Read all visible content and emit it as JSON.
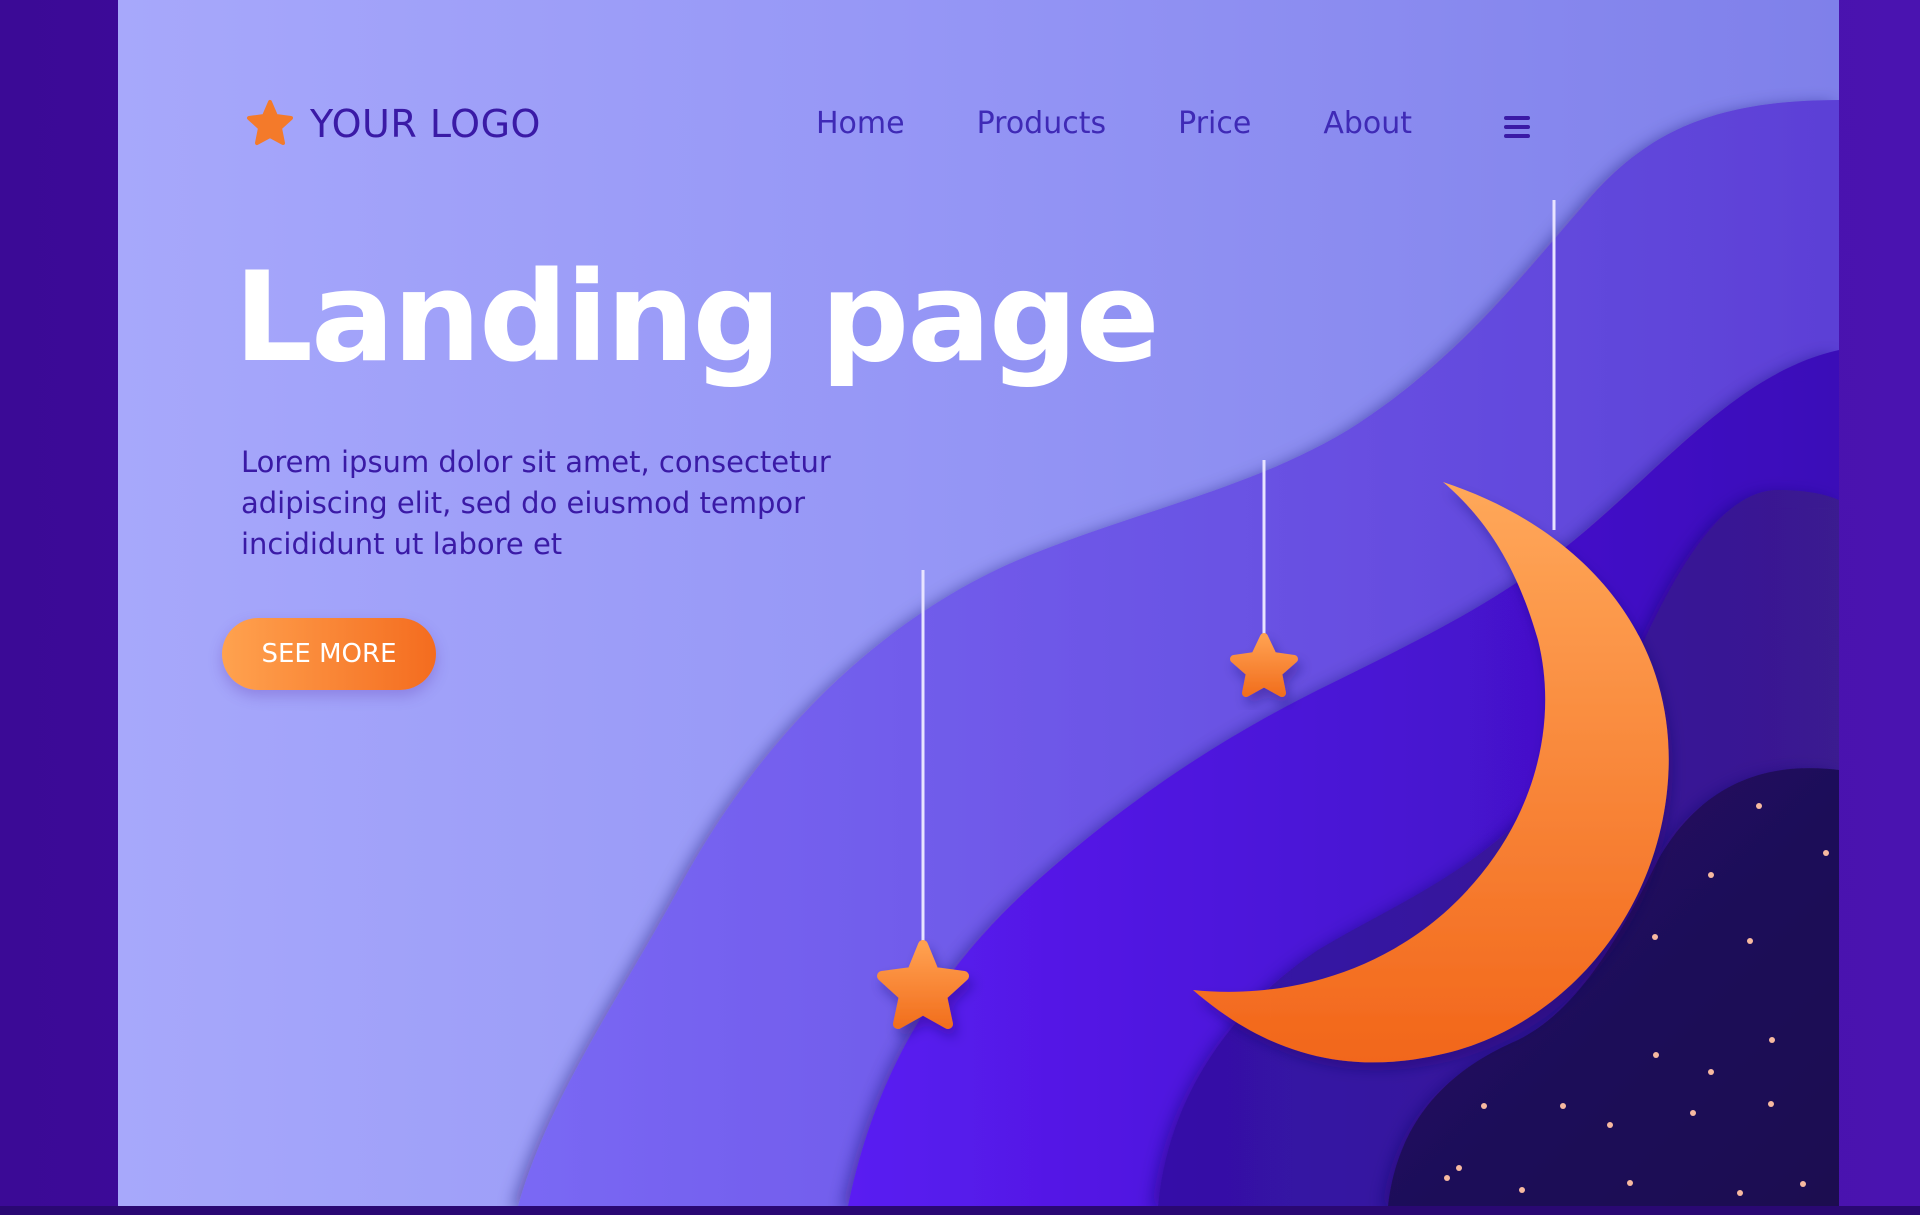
{
  "logo": {
    "text": "YOUR LOGO",
    "icon": "star-icon"
  },
  "nav": {
    "links": [
      "Home",
      "Products",
      "Price",
      "About"
    ],
    "menu_icon": "hamburger-menu-icon"
  },
  "hero": {
    "title": "Landing page",
    "body": "Lorem ipsum dolor sit amet, consectetur adipiscing elit, sed do eiusmod tempor incididunt ut labore et",
    "cta_label": "SEE MORE"
  },
  "colors": {
    "accent": "#f47a2a",
    "text_primary": "#3a1aa6",
    "background_light": "#a7a8fb",
    "background_dark": "#3b0a96"
  }
}
